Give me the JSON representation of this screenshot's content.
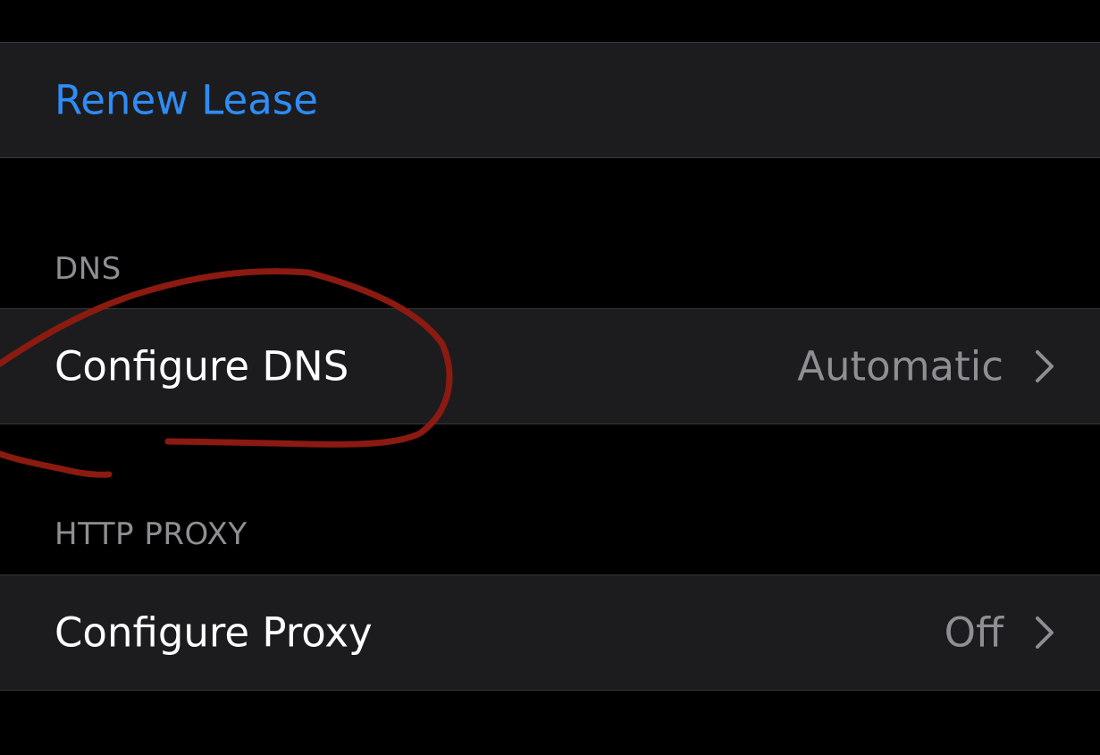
{
  "renew": {
    "label": "Renew Lease"
  },
  "dns_section": {
    "header": "DNS",
    "row": {
      "label": "Configure DNS",
      "value": "Automatic"
    }
  },
  "proxy_section": {
    "header": "HTTP PROXY",
    "row": {
      "label": "Configure Proxy",
      "value": "Off"
    }
  },
  "colors": {
    "background": "#000000",
    "cell": "#1c1c1e",
    "accent": "#2f8cf5",
    "secondary_text": "#8e8e93",
    "annotation_stroke": "#8b1a10"
  },
  "icons": {
    "disclosure": "chevron-right-icon",
    "annotation": "hand-drawn-circle"
  }
}
